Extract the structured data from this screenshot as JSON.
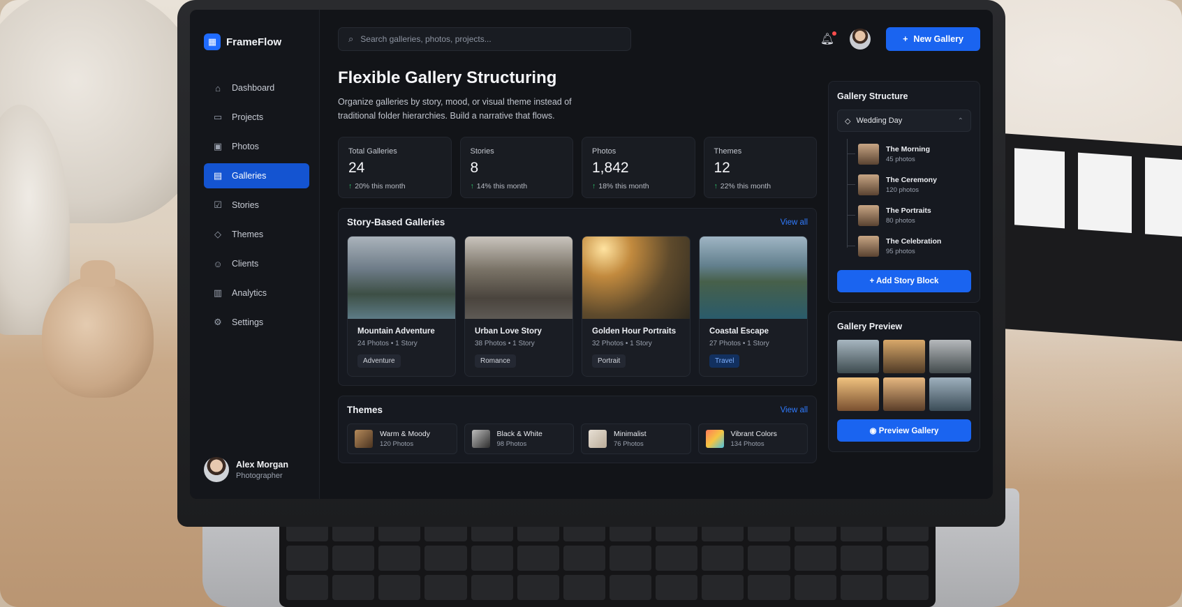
{
  "app": {
    "name": "FrameFlow"
  },
  "sidebar": {
    "items": [
      {
        "label": "Dashboard",
        "icon": "home-icon",
        "glyph": "⌂"
      },
      {
        "label": "Projects",
        "icon": "folder-icon",
        "glyph": "▭"
      },
      {
        "label": "Photos",
        "icon": "image-icon",
        "glyph": "▣"
      },
      {
        "label": "Galleries",
        "icon": "gallery-icon",
        "glyph": "▤"
      },
      {
        "label": "Stories",
        "icon": "story-icon",
        "glyph": "☑"
      },
      {
        "label": "Themes",
        "icon": "tag-icon",
        "glyph": "◇"
      },
      {
        "label": "Clients",
        "icon": "users-icon",
        "glyph": "☺"
      },
      {
        "label": "Analytics",
        "icon": "chart-icon",
        "glyph": "▥"
      },
      {
        "label": "Settings",
        "icon": "gear-icon",
        "glyph": "⚙"
      }
    ],
    "active": "Galleries"
  },
  "user": {
    "name": "Alex Morgan",
    "role": "Photographer"
  },
  "search": {
    "placeholder": "Search galleries, photos, projects..."
  },
  "actions": {
    "new_gallery": "New Gallery"
  },
  "page": {
    "title": "Flexible Gallery Structuring",
    "subtitle": "Organize galleries by story, mood, or visual theme instead of traditional folder hierarchies.  Build a narrative that flows."
  },
  "stats": [
    {
      "label": "Total Galleries",
      "value": "24",
      "delta": "20% this month"
    },
    {
      "label": "Stories",
      "value": "8",
      "delta": "14% this month"
    },
    {
      "label": "Photos",
      "value": "1,842",
      "delta": "18% this month"
    },
    {
      "label": "Themes",
      "value": "12",
      "delta": "22% this month"
    }
  ],
  "story_galleries": {
    "title": "Story-Based Galleries",
    "view_all": "View all",
    "items": [
      {
        "name": "Mountain Adventure",
        "photos": "24 Photos",
        "stories": "1 Story",
        "tag": "Adventure"
      },
      {
        "name": "Urban Love Story",
        "photos": "38 Photos",
        "stories": "1 Story",
        "tag": "Romance"
      },
      {
        "name": "Golden Hour Portraits",
        "photos": "32 Photos",
        "stories": "1 Story",
        "tag": "Portrait"
      },
      {
        "name": "Coastal Escape",
        "photos": "27 Photos",
        "stories": "1 Story",
        "tag": "Travel"
      }
    ]
  },
  "themes": {
    "title": "Themes",
    "view_all": "View all",
    "items": [
      {
        "name": "Warm & Moody",
        "count": "120 Photos"
      },
      {
        "name": "Black & White",
        "count": "98 Photos"
      },
      {
        "name": "Minimalist",
        "count": "76 Photos"
      },
      {
        "name": "Vibrant Colors",
        "count": "134 Photos"
      }
    ]
  },
  "structure": {
    "title": "Gallery Structure",
    "selected": "Wedding Day",
    "blocks": [
      {
        "name": "The Morning",
        "count": "45 photos"
      },
      {
        "name": "The Ceremony",
        "count": "120 photos"
      },
      {
        "name": "The Portraits",
        "count": "80 photos"
      },
      {
        "name": "The Celebration",
        "count": "95 photos"
      }
    ],
    "add_label": "Add Story Block"
  },
  "preview": {
    "title": "Gallery Preview",
    "button": "Preview Gallery"
  },
  "colors": {
    "accent": "#1a64f0",
    "positive": "#2ecc71",
    "notification": "#ff4d4d"
  }
}
